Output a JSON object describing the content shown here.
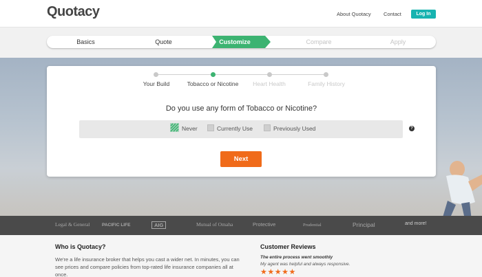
{
  "header": {
    "logo": "Quotacy",
    "nav": {
      "about": "About Quotacy",
      "contact": "Contact",
      "login": "Log In"
    }
  },
  "steps": {
    "items": [
      {
        "label": "Basics",
        "state": "done"
      },
      {
        "label": "Quote",
        "state": "done"
      },
      {
        "label": "Customize",
        "state": "active"
      },
      {
        "label": "Compare",
        "state": "todo"
      },
      {
        "label": "Apply",
        "state": "todo"
      }
    ]
  },
  "progress": {
    "items": [
      {
        "label": "Your Build",
        "state": "done"
      },
      {
        "label": "Tobacco or Nicotine",
        "state": "active"
      },
      {
        "label": "Heart Health",
        "state": "todo"
      },
      {
        "label": "Family History",
        "state": "todo"
      }
    ]
  },
  "question": {
    "text": "Do you use any form of Tobacco or Nicotine?",
    "options": [
      {
        "label": "Never",
        "checked": true
      },
      {
        "label": "Currently Use",
        "checked": false
      },
      {
        "label": "Previously Used",
        "checked": false
      }
    ],
    "help": "?",
    "next": "Next"
  },
  "partners": {
    "items": [
      "Legal & General",
      "PACIFIC LIFE",
      "AIG",
      "Mutual of Omaha",
      "Protective",
      "Prudential",
      "Principal",
      "and more!"
    ]
  },
  "about": {
    "title": "Who is Quotacy?",
    "text": "We're a life insurance broker that helps you cast a wider net. In minutes, you can see prices and compare policies from top-rated life insurance companies all at once."
  },
  "reviews": {
    "title": "Customer Reviews",
    "headline": "The entire process went smoothly",
    "body": "My agent was helpful and always responsive.",
    "stars": "★★★★★"
  },
  "colors": {
    "accent_teal": "#17b3b0",
    "step_active": "#3cb371",
    "cta_orange": "#f06b1a"
  }
}
